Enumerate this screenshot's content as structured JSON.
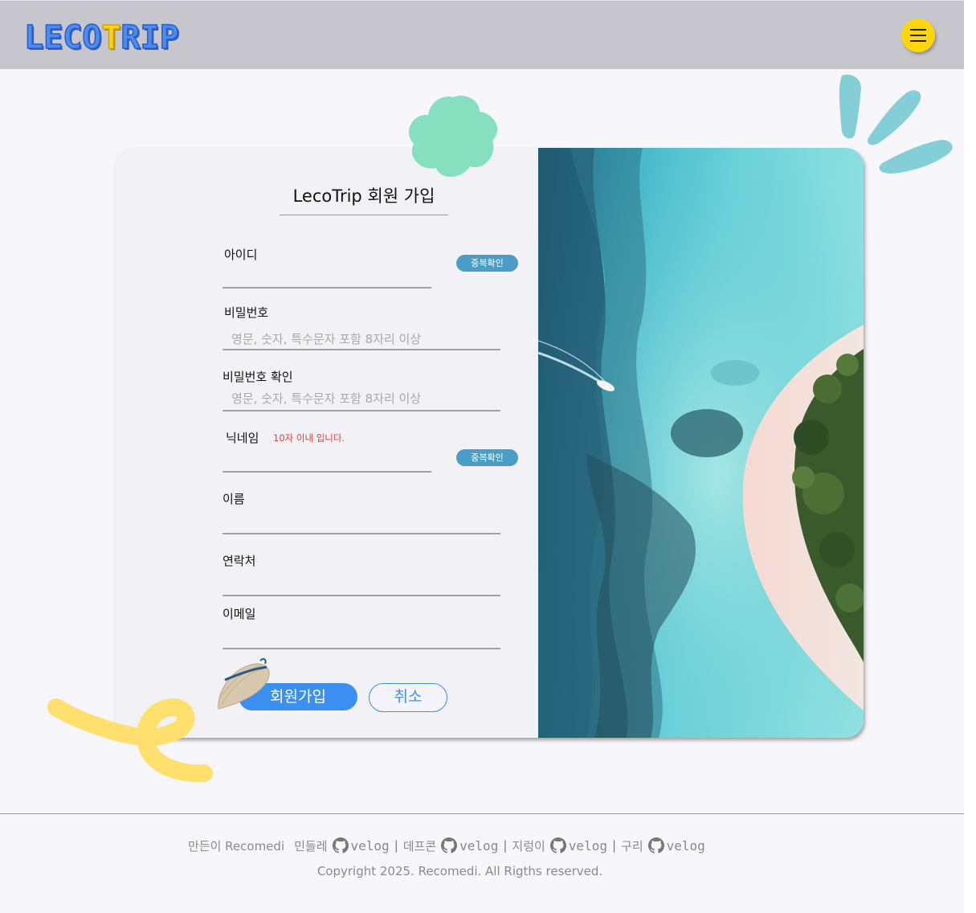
{
  "header": {
    "logo_left": "LECO",
    "logo_accent": "T",
    "logo_right": "RIP"
  },
  "form": {
    "title": "LecoTrip 회원 가입",
    "fields": {
      "id": {
        "label": "아이디",
        "value": "",
        "check_button": "중복확인"
      },
      "password": {
        "label": "비밀번호",
        "placeholder": "영문, 숫자, 특수문자 포함 8자리 이상"
      },
      "password_confirm": {
        "label": "비밀번호 확인",
        "placeholder": "영문, 숫자, 특수문자 포함 8자리 이상"
      },
      "nickname": {
        "label": "닉네임",
        "hint": "10자 이내 입니다.",
        "check_button": "중복확인"
      },
      "name": {
        "label": "이름"
      },
      "phone": {
        "label": "연락처"
      },
      "email": {
        "label": "이메일"
      }
    },
    "submit_label": "회원가입",
    "cancel_label": "취소"
  },
  "footer": {
    "made_by": "만든이 Recomedi",
    "members": [
      {
        "name": "민들레",
        "link": "velog"
      },
      {
        "name": "데프콘",
        "link": "velog"
      },
      {
        "name": "지렁이",
        "link": "velog"
      },
      {
        "name": "구리",
        "link": "velog"
      }
    ],
    "separator": "|",
    "copyright": "Copyright 2025. Recomedi. All Rigths reserved."
  },
  "colors": {
    "primary": "#3b8ff1",
    "check_button": "#4a9ec6",
    "hint": "#d0453f",
    "menu": "#ffd60a",
    "header_bg": "#c6c6cc"
  },
  "icons": [
    "hamburger-menu-icon",
    "github-icon",
    "straw-hat-icon",
    "flower-icon",
    "splash-icon",
    "swirl-icon"
  ]
}
